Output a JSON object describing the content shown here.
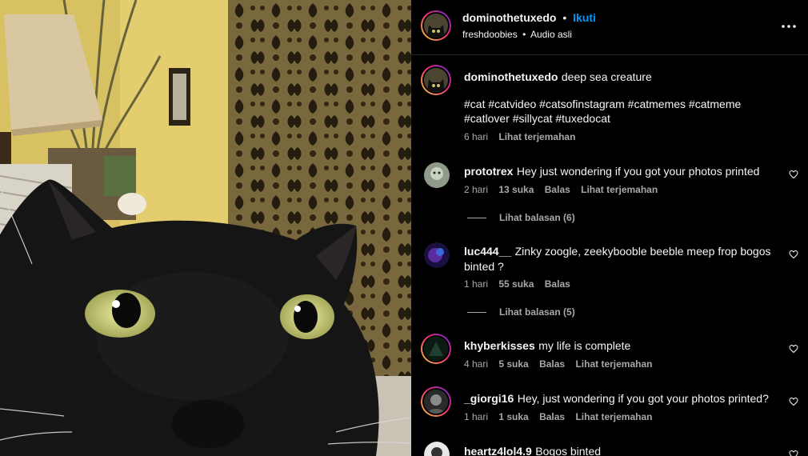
{
  "post": {
    "author": "dominothetuxedo",
    "follow_label": "Ikuti",
    "separator": "•",
    "audio_user": "freshdoobies",
    "audio_title": "Audio asli",
    "more_icon": "more-horizontal-icon"
  },
  "caption": {
    "author": "dominothetuxedo",
    "text": "deep sea creature",
    "hashtags": "#cat #catvideo #catsofinstagram #catmemes #catmeme #catlover #sillycat #tuxedocat",
    "time": "6 hari",
    "translate": "Lihat terjemahan"
  },
  "comments": [
    {
      "user": "prototrex",
      "text": "Hey just wondering if you got your photos printed",
      "time": "2 hari",
      "likes": "13 suka",
      "reply": "Balas",
      "translate": "Lihat terjemahan",
      "replies": "Lihat balasan (6)"
    },
    {
      "user": "luc444__",
      "text": "Zinky zoogle, zeekybooble beeble meep frop bogos binted ?",
      "time": "1 hari",
      "likes": "55 suka",
      "reply": "Balas",
      "translate": "",
      "replies": "Lihat balasan (5)"
    },
    {
      "user": "khyberkisses",
      "text": "my life is complete",
      "time": "4 hari",
      "likes": "5 suka",
      "reply": "Balas",
      "translate": "Lihat terjemahan",
      "replies": ""
    },
    {
      "user": "_giorgi16",
      "text": "Hey, just wondering if you got your photos printed?",
      "time": "1 hari",
      "likes": "1 suka",
      "reply": "Balas",
      "translate": "Lihat terjemahan",
      "replies": ""
    },
    {
      "user": "heartz4lol4.9",
      "text": "Bogos binted",
      "time": "",
      "likes": "",
      "reply": "",
      "translate": "",
      "replies": ""
    }
  ],
  "colors": {
    "link": "#0095f6",
    "muted": "#a8a8a8",
    "text": "#f5f5f5",
    "background": "#000000"
  }
}
